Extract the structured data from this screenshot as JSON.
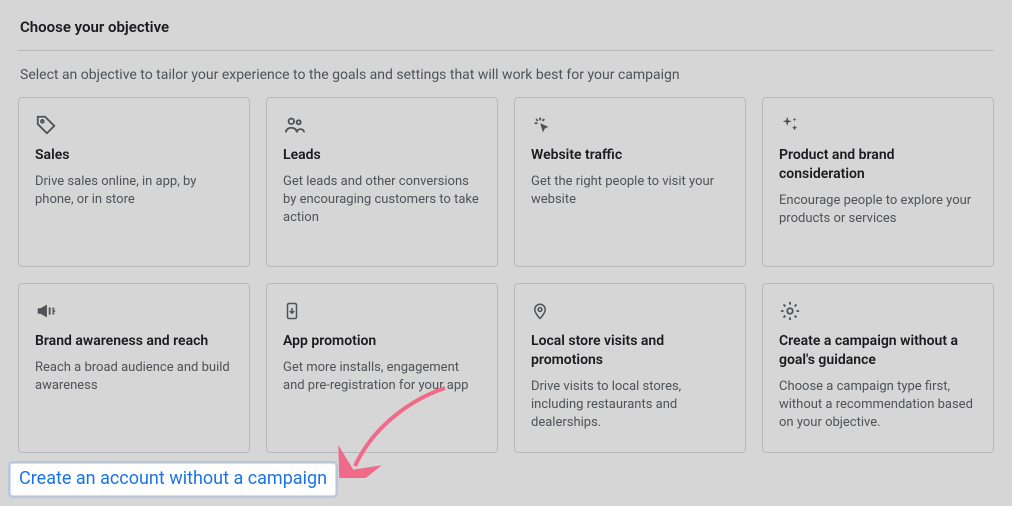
{
  "title": "Choose your objective",
  "subheading": "Select an objective to tailor your experience to the goals and settings that will work best for your campaign",
  "cards": [
    {
      "icon": "tag-icon",
      "title": "Sales",
      "desc": "Drive sales online, in app, by phone, or in store"
    },
    {
      "icon": "people-icon",
      "title": "Leads",
      "desc": "Get leads and other conversions by encouraging customers to take action"
    },
    {
      "icon": "click-icon",
      "title": "Website traffic",
      "desc": "Get the right people to visit your website"
    },
    {
      "icon": "sparkle-icon",
      "title": "Product and brand consideration",
      "desc": "Encourage people to explore your products or services"
    },
    {
      "icon": "megaphone-icon",
      "title": "Brand awareness and reach",
      "desc": "Reach a broad audience and build awareness"
    },
    {
      "icon": "app-icon",
      "title": "App promotion",
      "desc": "Get more installs, engagement and pre-registration for your app"
    },
    {
      "icon": "pin-icon",
      "title": "Local store visits and promotions",
      "desc": "Drive visits to local stores, including restaurants and dealerships."
    },
    {
      "icon": "gear-icon",
      "title": "Create a campaign without a goal's guidance",
      "desc": "Choose a campaign type first, without a recommendation based on your objective."
    }
  ],
  "bottom_link": "Create an account without a campaign"
}
